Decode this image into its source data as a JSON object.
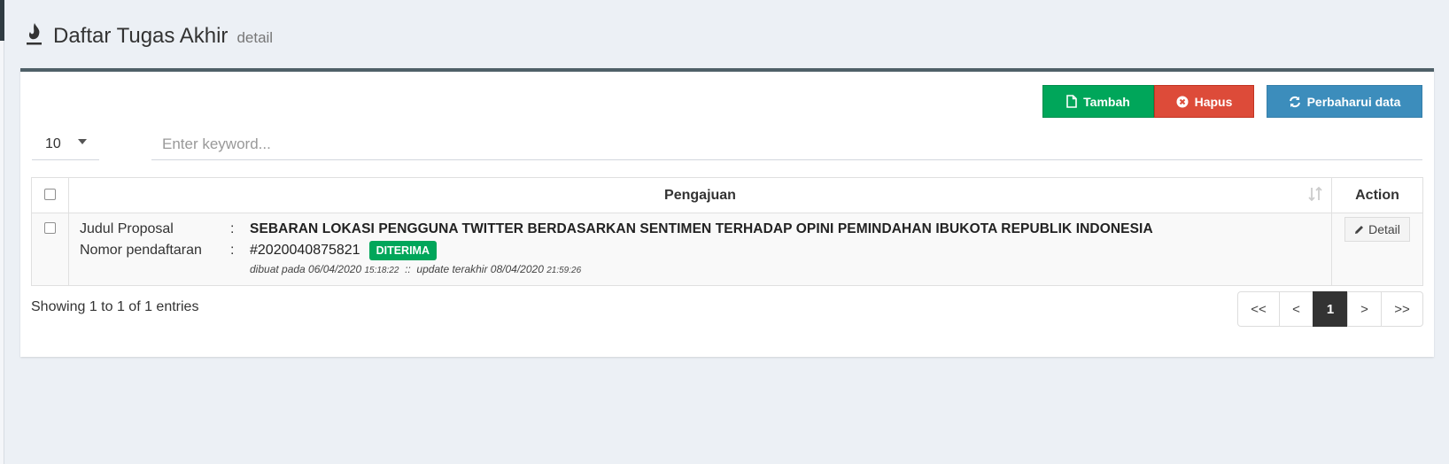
{
  "header": {
    "title": "Daftar Tugas Akhir",
    "subtitle": "detail"
  },
  "toolbar": {
    "add_label": "Tambah",
    "delete_label": "Hapus",
    "refresh_label": "Perbaharui data"
  },
  "filters": {
    "page_length": "10",
    "search_placeholder": "Enter keyword..."
  },
  "table": {
    "headers": {
      "pengajuan": "Pengajuan",
      "action": "Action"
    },
    "rows": [
      {
        "title_label": "Judul Proposal",
        "title_value": "SEBARAN LOKASI PENGGUNA TWITTER BERDASARKAN SENTIMEN TERHADAP OPINI PEMINDAHAN IBUKOTA REPUBLIK INDONESIA",
        "number_label": "Nomor pendaftaran",
        "number_value": "#2020040875821",
        "separator": ":",
        "status": "DITERIMA",
        "created_prefix": "dibuat pada 06/04/2020",
        "created_time": "15:18:22",
        "meta_sep": "::",
        "updated_prefix": "update terakhir 08/04/2020",
        "updated_time": "21:59:26",
        "detail_label": "Detail"
      }
    ]
  },
  "footer": {
    "info": "Showing 1 to 1 of 1 entries",
    "pagination": [
      "<<",
      "<",
      "1",
      ">",
      ">>"
    ],
    "active_page": "1"
  },
  "colors": {
    "add": "#00a65a",
    "delete": "#dd4b39",
    "refresh": "#3c8dbc",
    "badge": "#00a65a",
    "box_top": "#4f6068"
  }
}
